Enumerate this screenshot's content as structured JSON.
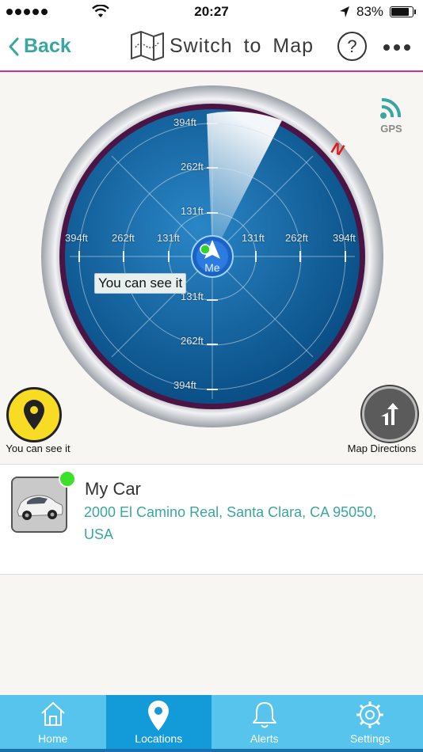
{
  "status_bar": {
    "time": "20:27",
    "battery": "83%",
    "battery_level": 0.83
  },
  "nav": {
    "back_label": "Back",
    "title": "Switch to Map",
    "help_symbol": "?"
  },
  "radar": {
    "top_labels": [
      "394ft",
      "262ft",
      "131ft"
    ],
    "left_labels": [
      "394ft",
      "262ft",
      "131ft"
    ],
    "right_labels": [
      "131ft",
      "262ft",
      "394ft"
    ],
    "bottom_labels": [
      "131ft",
      "262ft",
      "394ft"
    ],
    "north_label": "N",
    "me_label": "Me",
    "gps_label": "GPS",
    "tooltip": "You can see it"
  },
  "side_buttons": {
    "see_label": "You can see it",
    "map_directions_label": "Map Directions"
  },
  "locations": [
    {
      "name": "My Car",
      "address": "2000 El Camino Real, Santa Clara, CA 95050, USA",
      "status_color": "#3de02a"
    }
  ],
  "tabs": [
    {
      "label": "Home",
      "icon": "home-icon"
    },
    {
      "label": "Locations",
      "icon": "location-pin-icon",
      "active": true
    },
    {
      "label": "Alerts",
      "icon": "bell-icon"
    },
    {
      "label": "Settings",
      "icon": "gear-icon"
    }
  ],
  "colors": {
    "accent": "#3aa6a0",
    "divider": "#d4308a",
    "tab_bar": "#56c4ec",
    "tab_active": "#139ad9"
  }
}
